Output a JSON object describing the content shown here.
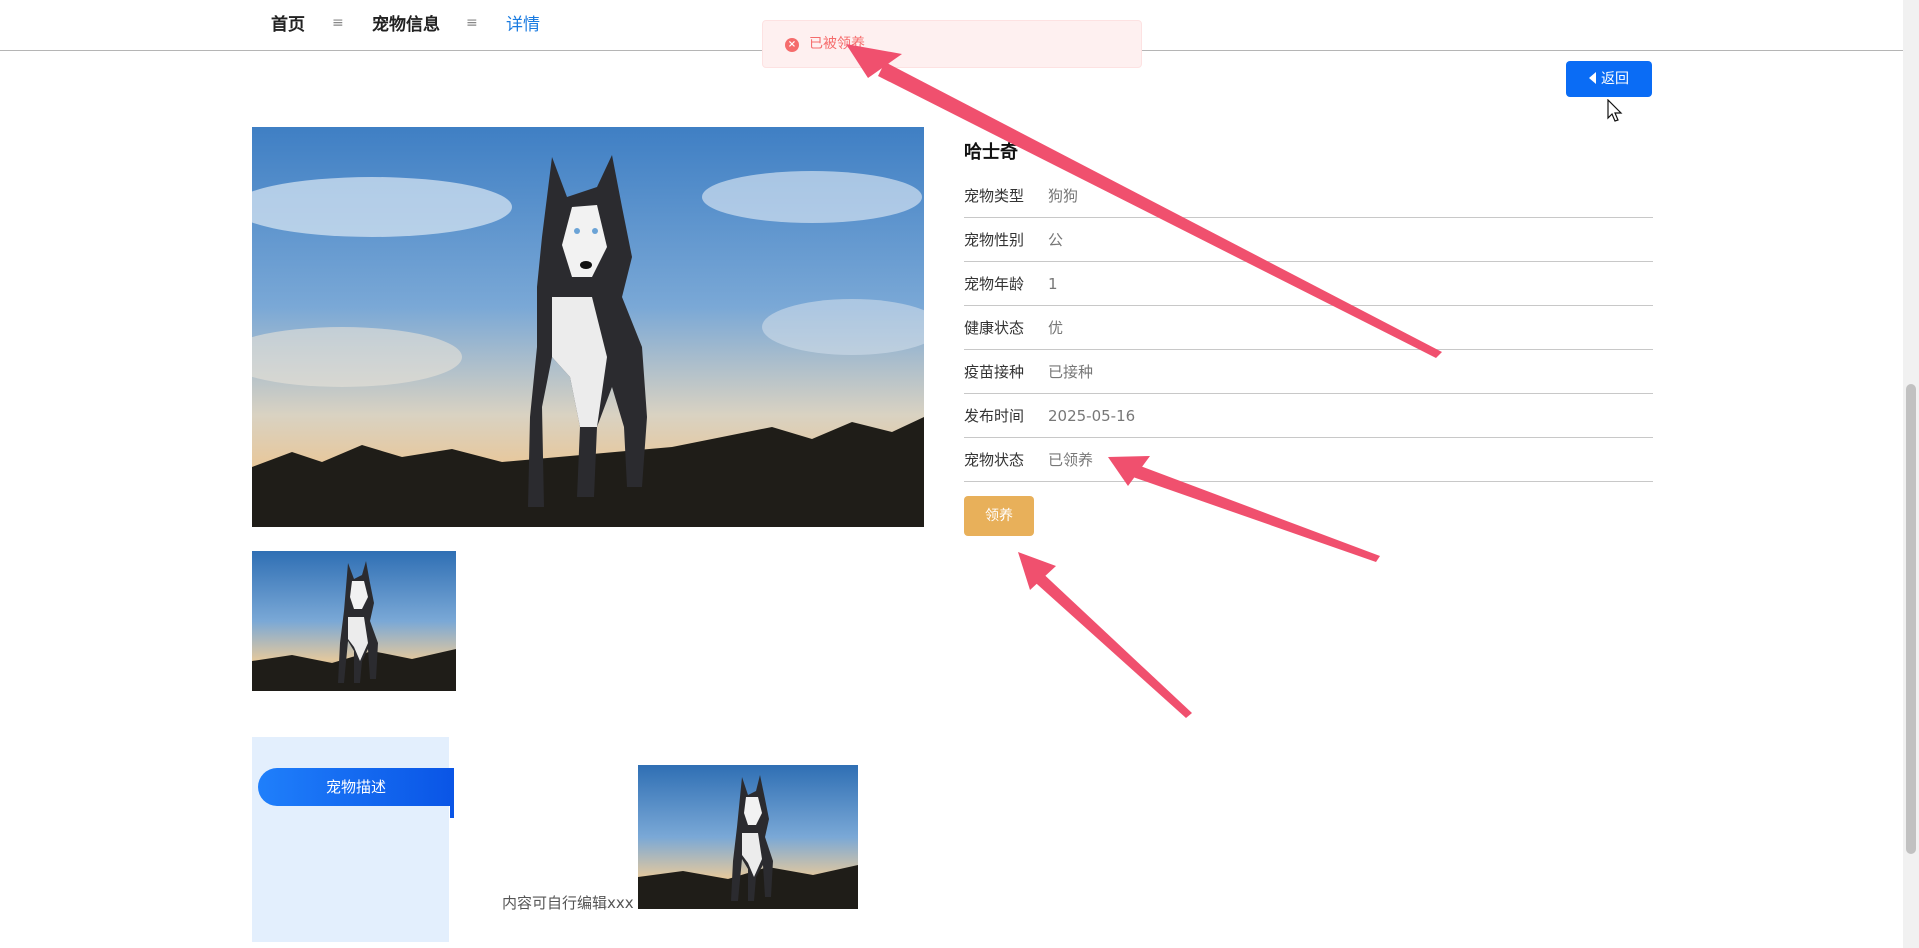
{
  "breadcrumb": {
    "home": "首页",
    "pet_info": "宠物信息",
    "detail": "详情",
    "separator": "≡"
  },
  "toast": {
    "message": "已被领养",
    "icon": "error-circle-icon"
  },
  "back_button": {
    "label": "返回",
    "icon": "caret-left-icon"
  },
  "pet": {
    "name": "哈士奇",
    "fields": [
      {
        "label": "宠物类型",
        "value": "狗狗"
      },
      {
        "label": "宠物性别",
        "value": "公"
      },
      {
        "label": "宠物年龄",
        "value": "1"
      },
      {
        "label": "健康状态",
        "value": "优"
      },
      {
        "label": "疫苗接种",
        "value": "已接种"
      },
      {
        "label": "发布时间",
        "value": "2025-05-16"
      },
      {
        "label": "宠物状态",
        "value": "已领养"
      }
    ]
  },
  "adopt_button": {
    "label": "领养"
  },
  "description": {
    "tab_label": "宠物描述",
    "text": "内容可自行编辑xxx"
  },
  "colors": {
    "accent": "#0a6cf5",
    "adopt": "#e8b05a",
    "toast_text": "#f56c6c",
    "annotation_arrow": "#f0506e"
  },
  "carousel": {
    "next_icon": "chevron-right-icon"
  }
}
